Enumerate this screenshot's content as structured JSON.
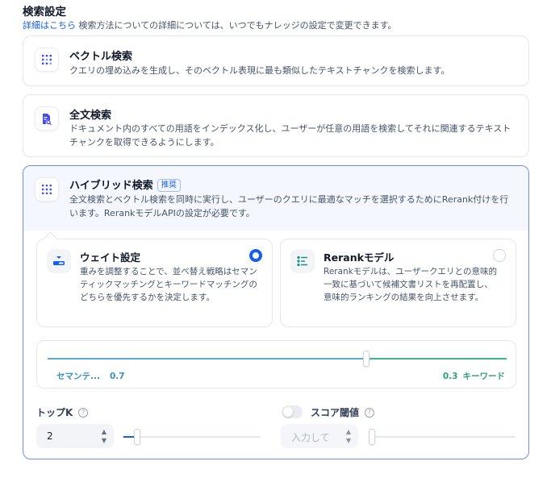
{
  "header": {
    "title": "検索設定",
    "learn_more": "詳細はこちら",
    "description": " 検索方法についての詳細については、いつでもナレッジの設定で変更できます。"
  },
  "methods": {
    "vector": {
      "title": "ベクトル検索",
      "description": "クエリの埋め込みを生成し、そのベクトル表現に最も類似したテキストチャンクを検索します。",
      "icon": "vector-grid-icon"
    },
    "fulltext": {
      "title": "全文検索",
      "description": "ドキュメント内のすべての用語をインデックス化し、ユーザーが任意の用語を検索してそれに関連するテキストチャンクを取得できるようにします。",
      "icon": "document-search-icon"
    },
    "hybrid": {
      "title": "ハイブリッド検索",
      "badge": "推奨",
      "description": "全文検索とベクトル検索を同時に実行し、ユーザーのクエリに最適なマッチを選択するためにRerank付けを行います。RerankモデルAPIの設定が必要です。",
      "icon": "hybrid-grid-icon",
      "selected": true
    }
  },
  "rerank_options": {
    "weight": {
      "title": "ウェイト設定",
      "description": "重みを調整することで、並べ替え戦略はセマンティックマッチングとキーワードマッチングのどちらを優先するかを決定します。",
      "selected": true
    },
    "model": {
      "title": "Rerankモデル",
      "description": "Rerankモデルは、ユーザークエリとの意味的一致に基づいて候補文書リストを再配置し、意味的ランキングの結果を向上させます。",
      "selected": false
    }
  },
  "weights": {
    "semantic_label": "セマンテ...",
    "semantic_value": "0.7",
    "keyword_label": "キーワード",
    "keyword_value": "0.3"
  },
  "top_k": {
    "label": "トップK",
    "value": "2",
    "slider_fraction": 0.1
  },
  "score_threshold": {
    "label": "スコア閾値",
    "placeholder": "入力して",
    "enabled": false
  },
  "colors": {
    "accent": "#155eef",
    "semantic": "#3b8fc7",
    "keyword": "#2f9e78"
  }
}
